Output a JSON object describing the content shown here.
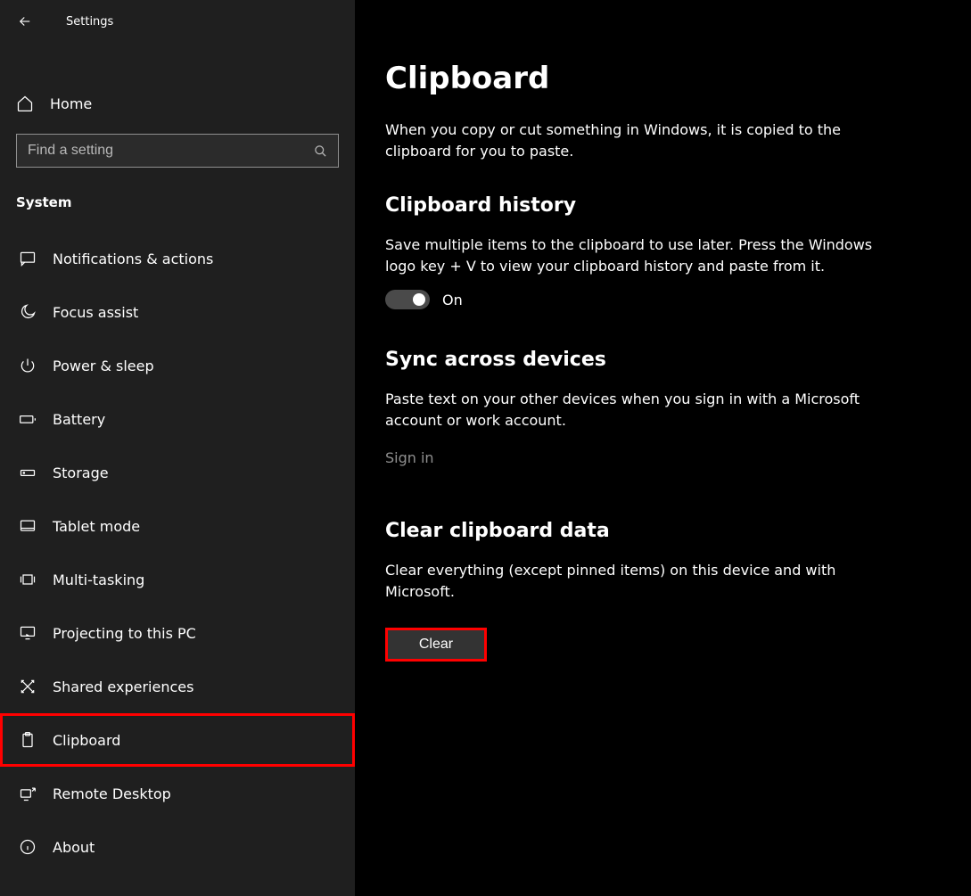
{
  "header": {
    "title": "Settings"
  },
  "home": {
    "label": "Home"
  },
  "search": {
    "placeholder": "Find a setting"
  },
  "category": {
    "label": "System"
  },
  "nav": [
    {
      "id": "notifications",
      "label": "Notifications & actions"
    },
    {
      "id": "focus-assist",
      "label": "Focus assist"
    },
    {
      "id": "power-sleep",
      "label": "Power & sleep"
    },
    {
      "id": "battery",
      "label": "Battery"
    },
    {
      "id": "storage",
      "label": "Storage"
    },
    {
      "id": "tablet-mode",
      "label": "Tablet mode"
    },
    {
      "id": "multi-tasking",
      "label": "Multi-tasking"
    },
    {
      "id": "projecting",
      "label": "Projecting to this PC"
    },
    {
      "id": "shared-experiences",
      "label": "Shared experiences"
    },
    {
      "id": "clipboard",
      "label": "Clipboard",
      "selected": true
    },
    {
      "id": "remote-desktop",
      "label": "Remote Desktop"
    },
    {
      "id": "about",
      "label": "About"
    }
  ],
  "page": {
    "title": "Clipboard",
    "subtitle": "When you copy or cut something in Windows, it is copied to the clipboard for you to paste."
  },
  "sections": {
    "history": {
      "title": "Clipboard history",
      "desc": "Save multiple items to the clipboard to use later. Press the Windows logo key + V to view your clipboard history and paste from it.",
      "toggle_state": "On"
    },
    "sync": {
      "title": "Sync across devices",
      "desc": "Paste text on your other devices when you sign in with a Microsoft account or work account.",
      "signin_label": "Sign in"
    },
    "clear": {
      "title": "Clear clipboard data",
      "desc": "Clear everything (except pinned items) on this device and with Microsoft.",
      "button_label": "Clear"
    }
  }
}
